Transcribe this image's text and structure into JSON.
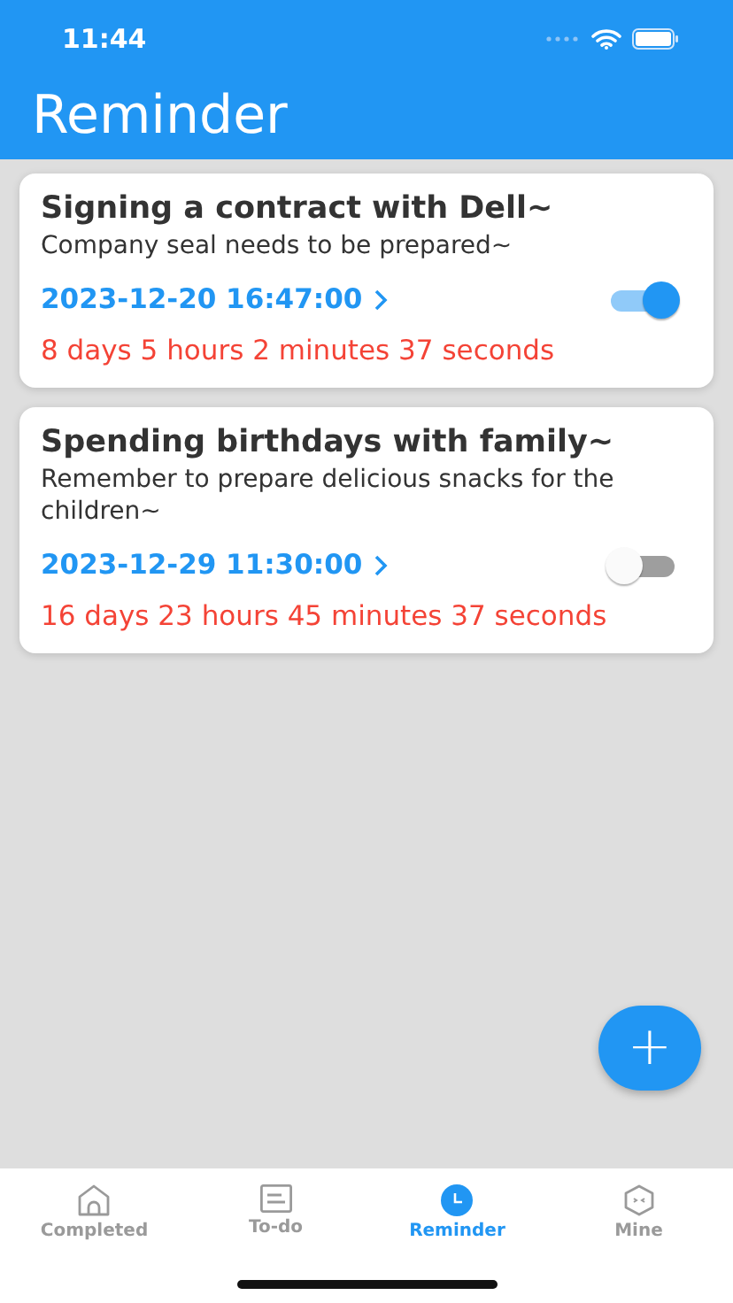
{
  "status_bar": {
    "time": "11:44"
  },
  "header": {
    "title": "Reminder"
  },
  "reminders": [
    {
      "title": "Signing a contract with Dell~",
      "note": "Company seal needs to be prepared~",
      "datetime": "2023-12-20 16:47:00",
      "on": true,
      "countdown": "8 days 5 hours 2 minutes 37 seconds"
    },
    {
      "title": "Spending birthdays with family~",
      "note": "Remember to prepare delicious snacks for the children~",
      "datetime": "2023-12-29 11:30:00",
      "on": false,
      "countdown": "16 days 23 hours 45 minutes 37 seconds"
    }
  ],
  "add_button": {
    "label": "+"
  },
  "tabs": [
    {
      "label": "Completed",
      "kind": "home",
      "selected": false
    },
    {
      "label": "To-do",
      "kind": "note",
      "selected": false
    },
    {
      "label": "Reminder",
      "kind": "clock",
      "selected": true
    },
    {
      "label": "Mine",
      "kind": "cube",
      "selected": false
    }
  ]
}
